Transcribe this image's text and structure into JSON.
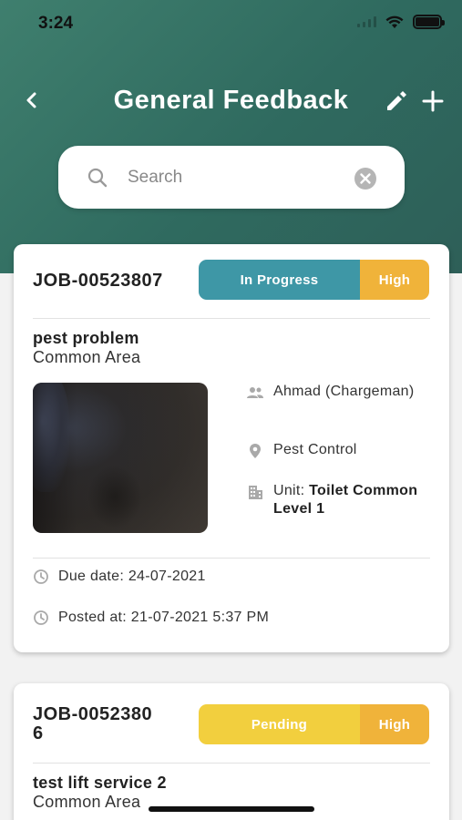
{
  "status_bar": {
    "time": "3:24"
  },
  "header": {
    "title": "General Feedback"
  },
  "search": {
    "placeholder": "Search"
  },
  "colors": {
    "in_progress": "#3e97a6",
    "pending": "#f2cf3e",
    "high": "#f0b33a",
    "header_start": "#3f7f6e",
    "header_end": "#2e5f58"
  },
  "jobs": [
    {
      "id": "JOB-00523807",
      "status": "In Progress",
      "priority": "High",
      "title": "pest problem",
      "location": "Common Area",
      "assignee": "Ahmad (Chargeman)",
      "category": "Pest Control",
      "unit_label": "Unit:",
      "unit_value": "Toilet Common Level 1",
      "due_date": "Due date: 24-07-2021",
      "posted_at": "Posted at: 21-07-2021 5:37 PM"
    },
    {
      "id_line1": "JOB-0052380",
      "id_line2": "6",
      "status": "Pending",
      "priority": "High",
      "title": "test lift service 2",
      "location": "Common Area"
    }
  ]
}
